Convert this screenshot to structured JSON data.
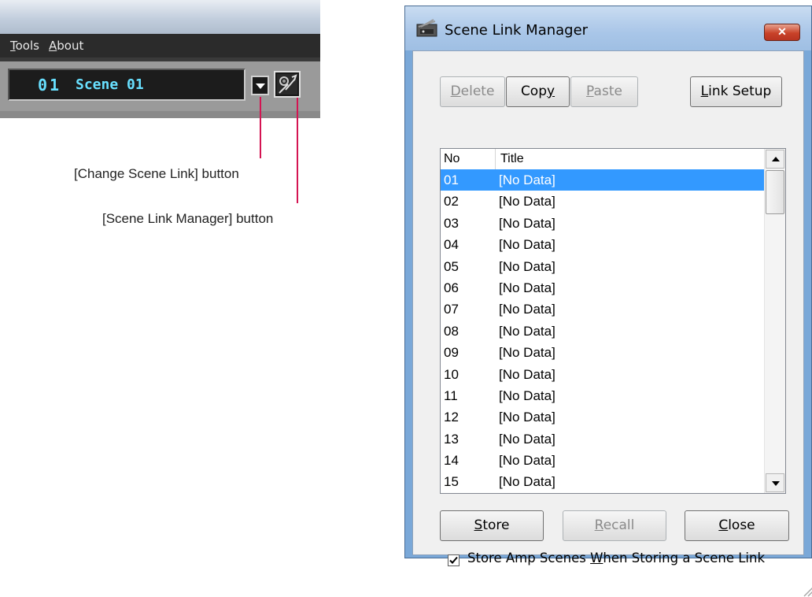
{
  "app": {
    "menu": [
      {
        "label": "Tools",
        "accel_index": 0
      },
      {
        "label": "About",
        "accel_index": 0
      }
    ],
    "scene": {
      "number": "01",
      "name": "Scene 01"
    },
    "callouts": {
      "change_scene_link": "[Change Scene Link] button",
      "scene_link_manager": "[Scene Link Manager] button"
    },
    "callout_color": "#d41452",
    "display_text_color": "#68e0ff"
  },
  "dialog": {
    "title": "Scene Link Manager",
    "close_icon": "close-icon",
    "buttons_top": {
      "delete": {
        "label": "Delete",
        "accel_index": 0,
        "enabled": false
      },
      "copy": {
        "label": "Copy",
        "accel_index": 3,
        "enabled": true
      },
      "paste": {
        "label": "Paste",
        "accel_index": 0,
        "enabled": false
      },
      "link_setup": {
        "label": "Link Setup",
        "accel_index": 0,
        "enabled": true
      }
    },
    "list": {
      "columns": [
        "No",
        "Title"
      ],
      "selected_index": 0,
      "selection_color": "#3399ff",
      "rows": [
        {
          "no": "01",
          "title": "[No Data]"
        },
        {
          "no": "02",
          "title": "[No Data]"
        },
        {
          "no": "03",
          "title": "[No Data]"
        },
        {
          "no": "04",
          "title": "[No Data]"
        },
        {
          "no": "05",
          "title": "[No Data]"
        },
        {
          "no": "06",
          "title": "[No Data]"
        },
        {
          "no": "07",
          "title": "[No Data]"
        },
        {
          "no": "08",
          "title": "[No Data]"
        },
        {
          "no": "09",
          "title": "[No Data]"
        },
        {
          "no": "10",
          "title": "[No Data]"
        },
        {
          "no": "11",
          "title": "[No Data]"
        },
        {
          "no": "12",
          "title": "[No Data]"
        },
        {
          "no": "13",
          "title": "[No Data]"
        },
        {
          "no": "14",
          "title": "[No Data]"
        },
        {
          "no": "15",
          "title": "[No Data]"
        }
      ]
    },
    "buttons_bottom": {
      "store": {
        "label": "Store",
        "accel_index": 0,
        "enabled": true
      },
      "recall": {
        "label": "Recall",
        "accel_index": 0,
        "enabled": false
      },
      "close": {
        "label": "Close",
        "accel_index": 0,
        "enabled": true
      }
    },
    "store_amp_checkbox": {
      "label": "Store Amp Scenes When Storing a Scene Link",
      "accel_index": 17,
      "checked": true
    }
  }
}
